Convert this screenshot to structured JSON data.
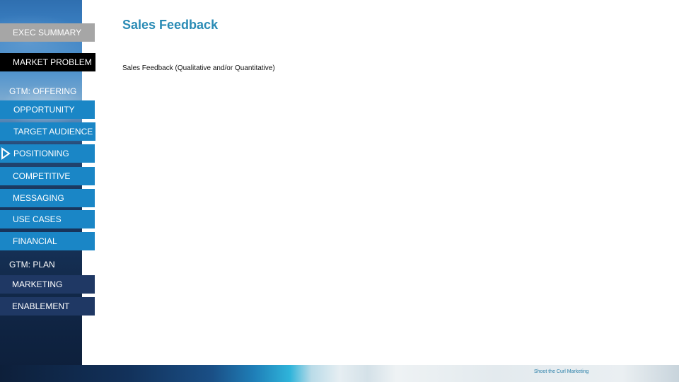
{
  "slide": {
    "title": "Sales Feedback",
    "subtitle": "Sales Feedback (Qualitative and/or Quantitative)",
    "footer_brand": "Shoot the Curl Marketing"
  },
  "sidebar": {
    "top_items": [
      {
        "label": "EXEC SUMMARY",
        "style": "gray"
      },
      {
        "label": "MARKET PROBLEM",
        "style": "black"
      }
    ],
    "sections": [
      {
        "label": "GTM: OFFERING",
        "items": [
          {
            "label": "OPPORTUNITY",
            "active": false
          },
          {
            "label": "TARGET AUDIENCE",
            "active": false
          },
          {
            "label": "POSITIONING",
            "active": true
          },
          {
            "label": "COMPETITIVE",
            "active": false
          },
          {
            "label": "MESSAGING",
            "active": false
          },
          {
            "label": "USE CASES",
            "active": false
          },
          {
            "label": "FINANCIAL",
            "active": false
          }
        ]
      },
      {
        "label": "GTM: PLAN",
        "items": [
          {
            "label": "MARKETING",
            "active": false
          },
          {
            "label": "ENABLEMENT",
            "active": false
          }
        ]
      }
    ],
    "active_indicator_icon": "triangle-right-outline"
  },
  "colors": {
    "title": "#2a8bb5",
    "exec_summary_bg": "#a6a6a6",
    "market_problem_bg": "#000000",
    "offering_item_bg": "#1a86c6",
    "plan_item_bg": "#1f3864",
    "footer_text": "#2a7fa8"
  }
}
